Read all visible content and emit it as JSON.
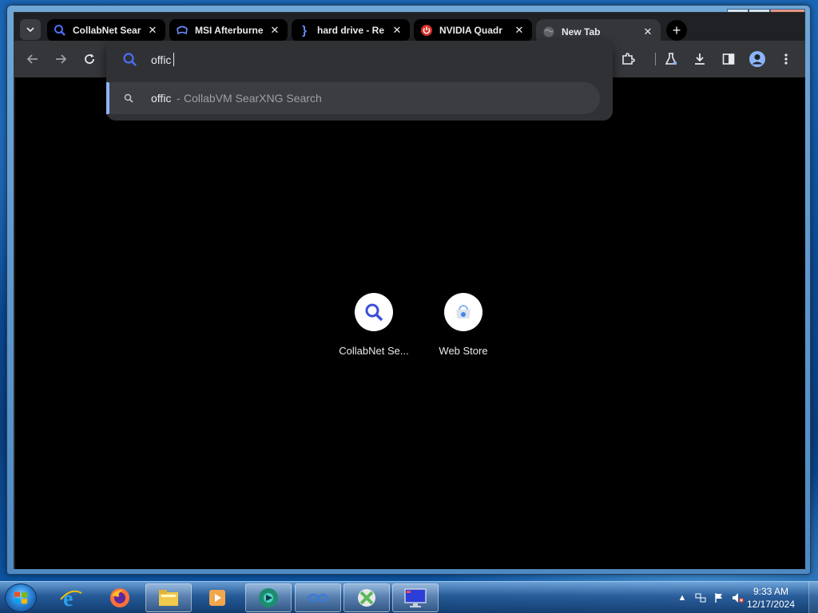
{
  "tabs": [
    {
      "title": "CollabNet Sear",
      "favicon": "search-icon",
      "active": false
    },
    {
      "title": "MSI Afterburne",
      "favicon": "msi-icon",
      "active": false
    },
    {
      "title": "hard drive - Re",
      "favicon": "brace-icon",
      "active": false
    },
    {
      "title": "NVIDIA Quadr",
      "favicon": "power-icon",
      "active": false
    },
    {
      "title": "New Tab",
      "favicon": "globe-icon",
      "active": true
    }
  ],
  "window_controls": {
    "minimize": "—",
    "maximize": "☐",
    "close": "✕"
  },
  "omnibox": {
    "value": "offic",
    "suggestion": {
      "query": "offic",
      "separator": "-",
      "description": "CollabVM SearXNG Search"
    }
  },
  "shortcuts": [
    {
      "label": "CollabNet Se...",
      "icon": "search-icon"
    },
    {
      "label": "Web Store",
      "icon": "web-store-icon"
    }
  ],
  "taskbar": {
    "apps": [
      "internet-explorer-icon",
      "firefox-icon",
      "file-explorer-icon",
      "media-player-icon",
      "chrome-app-icon",
      "teamviewer-icon",
      "xbox-icon",
      "monitor-icon"
    ]
  },
  "clock": {
    "time": "9:33 AM",
    "date": "12/17/2024"
  },
  "colors": {
    "accent": "#8ab4f8",
    "search_blue": "#4c6ef5"
  }
}
